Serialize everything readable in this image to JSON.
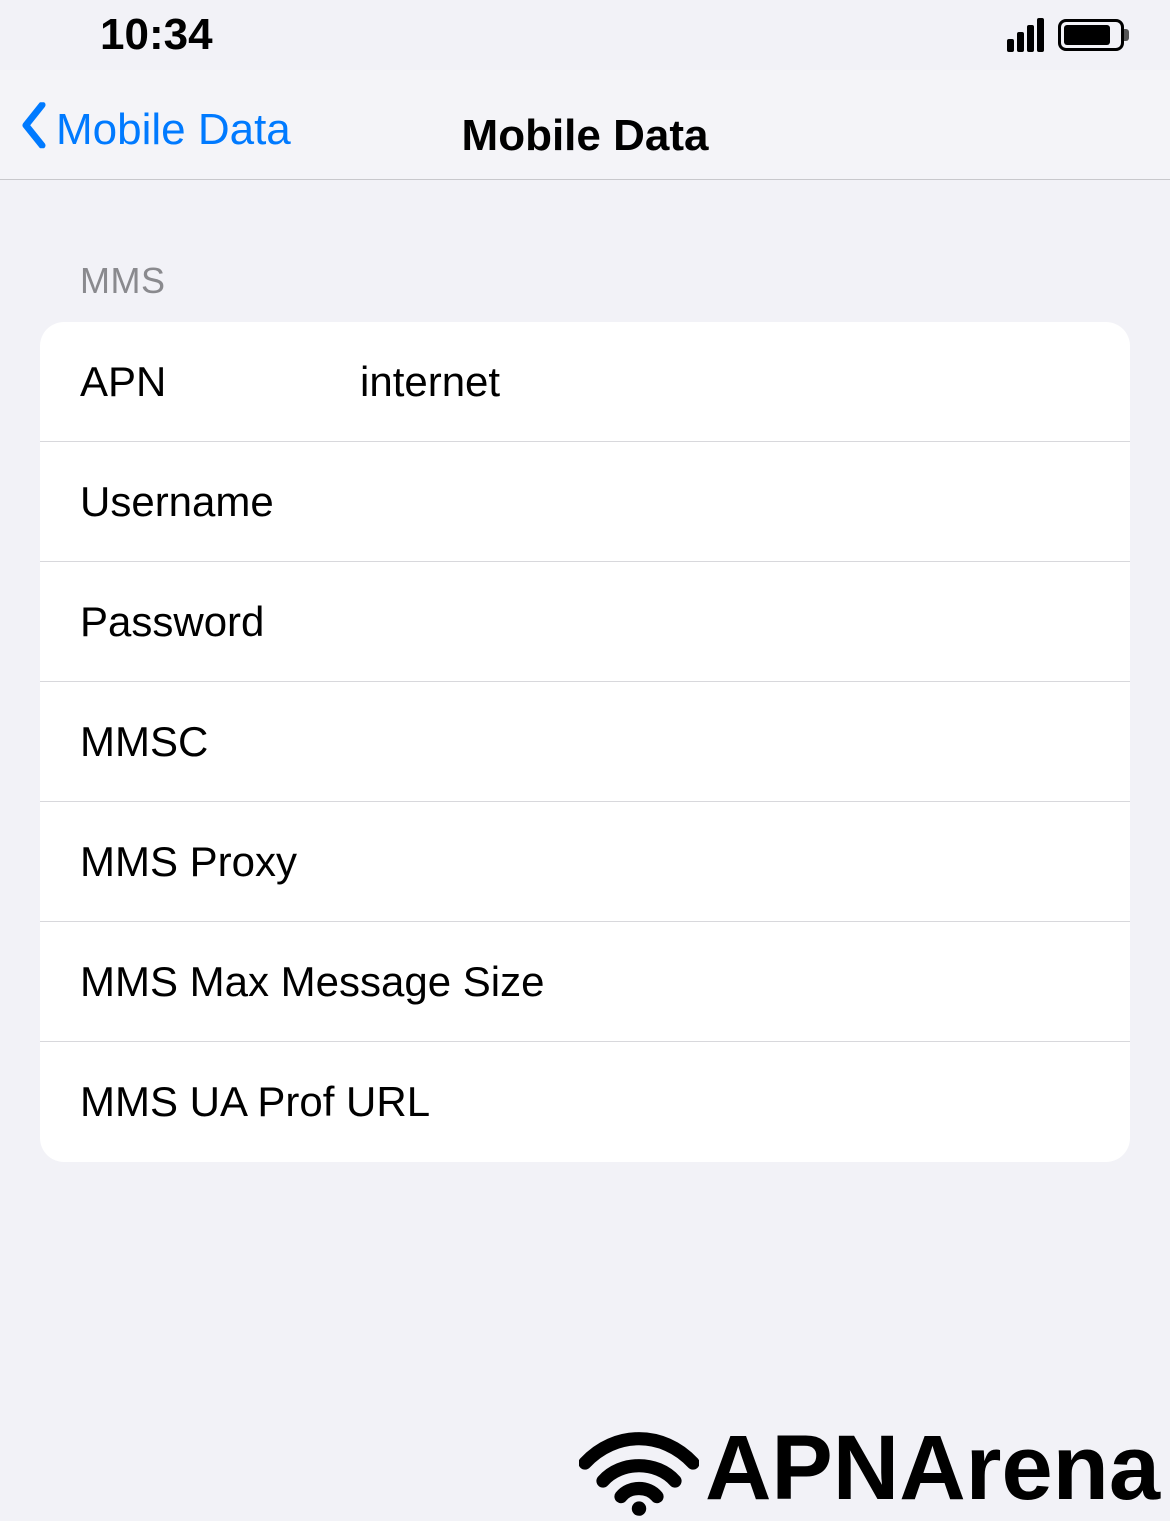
{
  "statusBar": {
    "time": "10:34"
  },
  "nav": {
    "back": "Mobile Data",
    "title": "Mobile Data"
  },
  "section": {
    "header": "MMS",
    "fields": {
      "apn": {
        "label": "APN",
        "value": "internet"
      },
      "username": {
        "label": "Username",
        "value": ""
      },
      "password": {
        "label": "Password",
        "value": ""
      },
      "mmsc": {
        "label": "MMSC",
        "value": ""
      },
      "mmsProxy": {
        "label": "MMS Proxy",
        "value": ""
      },
      "mmsMaxSize": {
        "label": "MMS Max Message Size",
        "value": ""
      },
      "mmsUaProf": {
        "label": "MMS UA Prof URL",
        "value": ""
      }
    }
  },
  "watermark": "APNArena",
  "brand": "APNArena"
}
